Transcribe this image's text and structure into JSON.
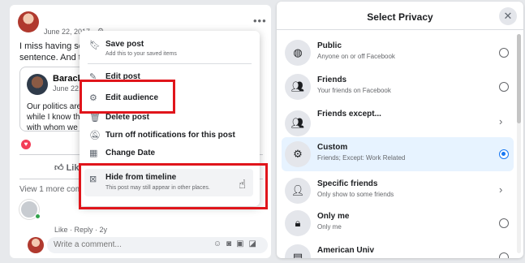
{
  "post": {
    "date": "June 22, 2017",
    "text_line1": "I miss having some",
    "text_line2": "sentence. And thes",
    "shared": {
      "name": "Barack O",
      "date": "June 22,",
      "text_line1": "Our politics are",
      "text_line2": "while I know th",
      "text_line3": "with whom we d"
    },
    "like_label": "Like",
    "view_more": "View 1 more comm",
    "like_reply": "Like · Reply · 2y",
    "comment_placeholder": "Write a comment..."
  },
  "menu": {
    "items": [
      {
        "label": "Save post",
        "sub": "Add this to your saved items",
        "icon": "bookmark-icon"
      },
      {
        "label": "Edit post",
        "icon": "pencil-icon"
      },
      {
        "label": "Edit audience",
        "icon": "gear-icon"
      },
      {
        "label": "Delete post",
        "icon": "trash-icon"
      },
      {
        "label": "Turn off notifications for this post",
        "icon": "bell-off-icon"
      },
      {
        "label": "Change Date",
        "icon": "calendar-icon"
      },
      {
        "label": "Hide from timeline",
        "sub": "This post may still appear in other places.",
        "icon": "hide-icon"
      }
    ]
  },
  "privacy": {
    "title": "Select Privacy",
    "options": [
      {
        "label": "Public",
        "sub": "Anyone on or off Facebook",
        "control": "radio",
        "selected": false,
        "icon": "globe-icon"
      },
      {
        "label": "Friends",
        "sub": "Your friends on Facebook",
        "control": "radio",
        "selected": false,
        "icon": "friends-icon"
      },
      {
        "label": "Friends except...",
        "sub": "",
        "control": "chevron",
        "selected": false,
        "icon": "friends-except-icon"
      },
      {
        "label": "Custom",
        "sub": "Friends; Except: Work Related",
        "control": "radio",
        "selected": true,
        "icon": "gear-icon"
      },
      {
        "label": "Specific friends",
        "sub": "Only show to some friends",
        "control": "chevron",
        "selected": false,
        "icon": "person-icon"
      },
      {
        "label": "Only me",
        "sub": "Only me",
        "control": "radio",
        "selected": false,
        "icon": "lock-icon"
      },
      {
        "label": "American Univ",
        "sub": "",
        "control": "radio",
        "selected": false,
        "icon": "group-icon"
      }
    ]
  },
  "colors": {
    "highlight": "#e0151b",
    "accent": "#1877f2",
    "selected_bg": "#e7f3ff"
  }
}
